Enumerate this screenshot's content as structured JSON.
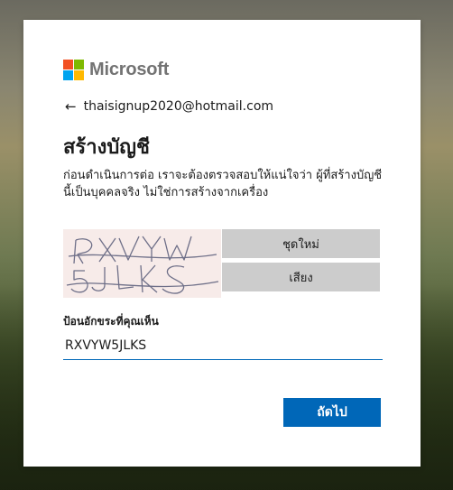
{
  "brand": {
    "name": "Microsoft",
    "colors": {
      "red": "#f25022",
      "green": "#7fba00",
      "blue": "#00a4ef",
      "yellow": "#ffb900"
    }
  },
  "account": {
    "back_icon": "arrow-left-icon",
    "email": "thaisignup2020@hotmail.com"
  },
  "page": {
    "title": "สร้างบัญชี",
    "description": "ก่อนดำเนินการต่อ เราจะต้องตรวจสอบให้แน่ใจว่า ผู้ที่สร้างบัญชีนี้เป็นบุคคลจริง ไม่ใช่การสร้างจากเครื่อง"
  },
  "captcha": {
    "line1": "RXVYW",
    "line2": "5JLKS",
    "new_button": "ชุดใหม่",
    "audio_button": "เสียง",
    "input_label": "ป้อนอักขระที่คุณเห็น",
    "input_value": "RXVYW5JLKS"
  },
  "actions": {
    "next": "ถัดไป",
    "accent_color": "#0067b8"
  }
}
